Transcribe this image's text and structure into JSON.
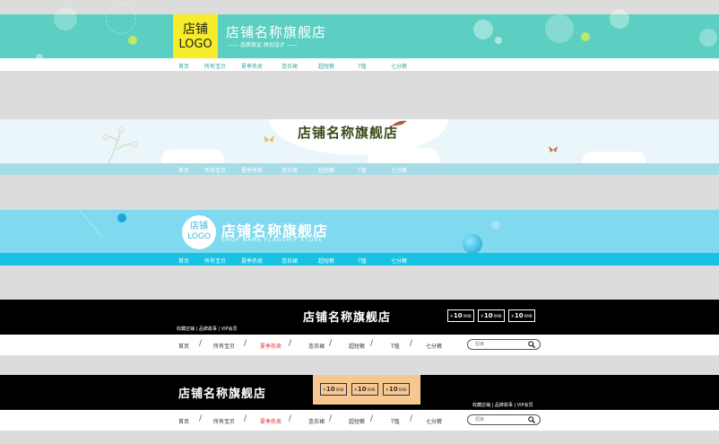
{
  "banner1": {
    "logo_line1": "店铺",
    "logo_line2": "LOGO",
    "title": "店铺名称旗舰店",
    "subtitle": "—— 品质保证 原创设计 ——",
    "nav": [
      "首页",
      "所有宝贝",
      "夏季热卖",
      "连衣裙",
      "超短裤",
      "T恤",
      "七分裤"
    ],
    "accent": "#5ccfc2"
  },
  "banner2": {
    "title": "店铺名称旗舰店",
    "nav": [
      "首页",
      "所有宝贝",
      "夏季热卖",
      "连衣裙",
      "超短裤",
      "T恤",
      "七分裤"
    ]
  },
  "banner3": {
    "logo_line1": "店铺",
    "logo_line2": "LOGO",
    "title": "店铺名称旗舰店",
    "subtitle": "SHOP NAME FLAGSHIP STORE",
    "nav": [
      "首页",
      "所有宝贝",
      "夏季热卖",
      "连衣裙",
      "超短裤",
      "T恤",
      "七分裤"
    ],
    "accent": "#18c2e3"
  },
  "banner4": {
    "title": "店铺名称旗舰店",
    "links": "收藏店铺 | 品牌故事 | VIP会员",
    "coupons": [
      {
        "sym": "¥",
        "amount": "10",
        "unit": "RMB"
      },
      {
        "sym": "¥",
        "amount": "10",
        "unit": "RMB"
      },
      {
        "sym": "¥",
        "amount": "10",
        "unit": "RMB"
      }
    ],
    "nav": [
      "首页",
      "所有宝贝",
      "夏季热卖",
      "连衣裙",
      "超短裤",
      "T恤",
      "七分裤"
    ],
    "search_placeholder": "短裤",
    "highlight_color": "#e03030"
  },
  "banner5": {
    "title": "店铺名称旗舰店",
    "links": "收藏店铺 | 品牌故事 | VIP会员",
    "coupons": [
      {
        "sym": "¥",
        "amount": "10",
        "unit": "RMB"
      },
      {
        "sym": "¥",
        "amount": "10",
        "unit": "RMB"
      },
      {
        "sym": "¥",
        "amount": "10",
        "unit": "RMB"
      }
    ],
    "nav": [
      "首页",
      "所有宝贝",
      "夏季热卖",
      "连衣裙",
      "超短裤",
      "T恤",
      "七分裤"
    ],
    "search_placeholder": "短裤",
    "highlight_color": "#e03030"
  }
}
